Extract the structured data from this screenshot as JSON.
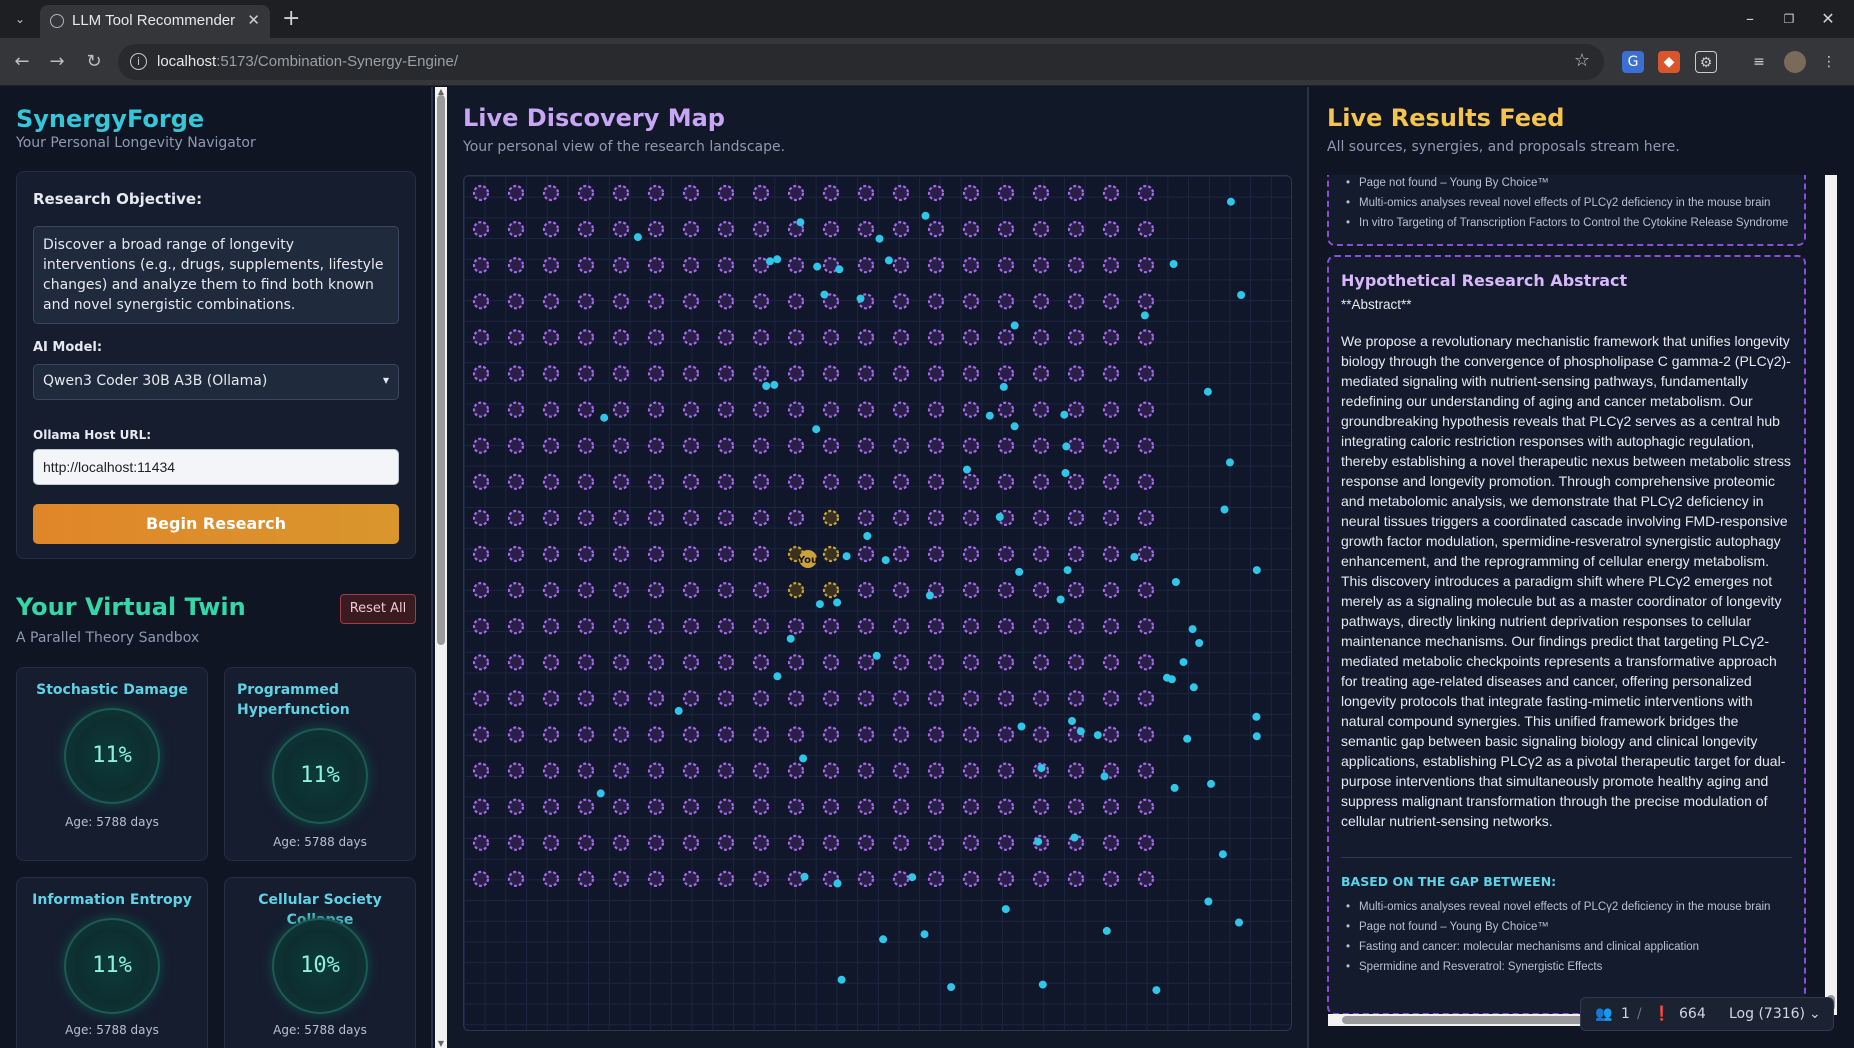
{
  "browser": {
    "tab_title": "LLM Tool Recommender",
    "url_host": "localhost",
    "url_rest": ":5173/Combination-Synergy-Engine/"
  },
  "sidebar": {
    "brand": "SynergyForge",
    "tagline": "Your Personal Longevity Navigator",
    "objective_label": "Research Objective:",
    "objective_text": "Discover a broad range of longevity interventions (e.g., drugs, supplements, lifestyle changes) and analyze them to find both known and novel synergistic combinations.",
    "model_label": "AI Model:",
    "model_value": "Qwen3 Coder 30B A3B (Ollama)",
    "host_label": "Ollama Host URL:",
    "host_value": "http://localhost:11434",
    "begin_button": "Begin Research"
  },
  "twin": {
    "title": "Your Virtual Twin",
    "subtitle": "A Parallel Theory Sandbox",
    "reset_button": "Reset All",
    "cards": [
      {
        "title": "Stochastic Damage",
        "value": "11%",
        "age": "Age: 5788 days"
      },
      {
        "title": "Programmed Hyperfunction",
        "value": "11%",
        "age": "Age: 5788 days"
      },
      {
        "title": "Information Entropy",
        "value": "11%",
        "age": "Age: 5788 days"
      },
      {
        "title": "Cellular Society Collapse",
        "value": "10%",
        "age": "Age: 5788 days"
      }
    ]
  },
  "map": {
    "title": "Live Discovery Map",
    "subtitle": "Your personal view of the research landscape.",
    "you_label": "You",
    "grid_cols": 20,
    "grid_rows": 20,
    "colors": {
      "node": "#a46ae8",
      "node_fill": "#2a1f48",
      "particle": "#2fc6e8",
      "you": "#c9a23a"
    }
  },
  "feed": {
    "title": "Live Results Feed",
    "subtitle": "All sources, synergies, and proposals stream here.",
    "prev_sources": [
      "Page not found – Young By Choice™",
      "Multi-omics analyses reveal novel effects of PLCγ2 deficiency in the mouse brain",
      "In vitro Targeting of Transcription Factors to Control the Cytokine Release Syndrome"
    ],
    "abstract_title": "Hypothetical Research Abstract",
    "abstract_heading": "**Abstract**",
    "abstract_body": "We propose a revolutionary mechanistic framework that unifies longevity biology through the convergence of phospholipase C gamma-2 (PLCγ2)-mediated signaling with nutrient-sensing pathways, fundamentally redefining our understanding of aging and cancer metabolism. Our groundbreaking hypothesis reveals that PLCγ2 serves as a central hub integrating caloric restriction responses with autophagic regulation, thereby establishing a novel therapeutic nexus between metabolic stress response and longevity promotion. Through comprehensive proteomic and metabolomic analysis, we demonstrate that PLCγ2 deficiency in neural tissues triggers a coordinated cascade involving FMD-responsive growth factor modulation, spermidine-resveratrol synergistic autophagy enhancement, and the reprogramming of cellular energy metabolism. This discovery introduces a paradigm shift where PLCγ2 emerges not merely as a signaling molecule but as a master coordinator of longevity pathways, directly linking nutrient deprivation responses to cellular maintenance mechanisms. Our findings predict that targeting PLCγ2-mediated metabolic checkpoints represents a transformative approach for treating age-related diseases and cancer, offering personalized longevity protocols that integrate fasting-mimetic interventions with natural compound synergies. This unified framework bridges the semantic gap between basic signaling biology and clinical longevity applications, establishing PLCγ2 as a pivotal therapeutic target for dual-purpose interventions that simultaneously promote healthy aging and suppress malignant transformation through the precise modulation of cellular nutrient-sensing networks.",
    "gap_label": "BASED ON THE GAP BETWEEN:",
    "gap_sources": [
      "Multi-omics analyses reveal novel effects of PLCγ2 deficiency in the mouse brain",
      "Page not found – Young By Choice™",
      "Fasting and cancer: molecular mechanisms and clinical application",
      "Spermidine and Resveratrol: Synergistic Effects"
    ]
  },
  "status": {
    "users": "1",
    "errors": "664",
    "log": "Log (7316)"
  }
}
